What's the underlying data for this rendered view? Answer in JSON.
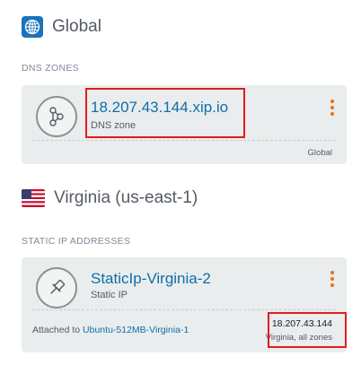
{
  "global_region": {
    "icon": "globe-icon",
    "label": "Global"
  },
  "dns_section": {
    "title": "DNS ZONES",
    "card": {
      "icon": "dns-nodes-icon",
      "title": "18.207.43.144.xip.io",
      "subtitle": "DNS zone",
      "footer_right": "Global",
      "menu_icon": "kebab-menu-icon"
    }
  },
  "virginia_region": {
    "icon": "us-flag-icon",
    "label": "Virginia (us-east-1)"
  },
  "static_ip_section": {
    "title": "STATIC IP ADDRESSES",
    "card": {
      "icon": "pin-icon",
      "title": "StaticIp-Virginia-2",
      "subtitle": "Static IP",
      "attached_prefix": "Attached to ",
      "attached_link": "Ubuntu-512MB-Virginia-1",
      "ip": "18.207.43.144",
      "location": "Virginia, all zones",
      "menu_icon": "kebab-menu-icon"
    }
  },
  "colors": {
    "link": "#0f6ea8",
    "accent_orange": "#ec7211",
    "card_bg": "#eaeded",
    "highlight": "#e01c1c",
    "globe_bg": "#1a73bb"
  }
}
